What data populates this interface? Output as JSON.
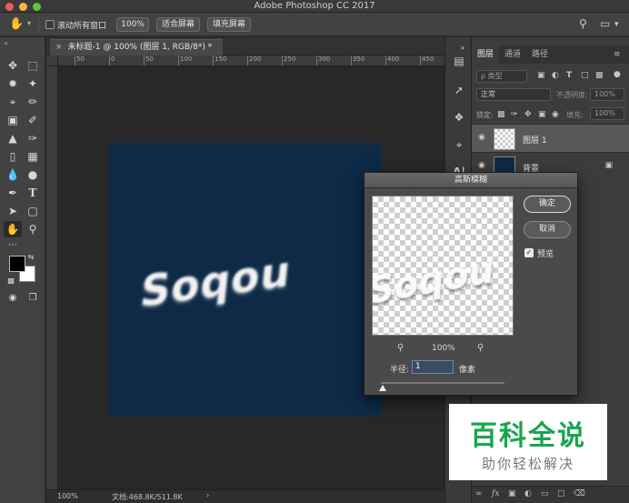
{
  "app": {
    "title": "Adobe Photoshop CC 2017"
  },
  "options_bar": {
    "scroll_all_label": "滚动所有窗口",
    "zoom_100_label": "100%",
    "fit_screen_label": "适合屏幕",
    "fill_screen_label": "填充屏幕"
  },
  "document": {
    "tab_title": "未标题-1 @ 100% (图层 1, RGB/8*) *",
    "close_glyph": "×"
  },
  "ruler": {
    "ticks": [
      "50",
      "0",
      "50",
      "100",
      "150",
      "200",
      "250",
      "300",
      "350",
      "400",
      "450"
    ]
  },
  "canvas": {
    "text": "Soqou",
    "background_color": "#0e2a47"
  },
  "status_bar": {
    "zoom": "100%",
    "doc_info": "文档:468.8K/511.8K",
    "arrow": "›"
  },
  "layers_panel": {
    "tabs": [
      {
        "label": "图层",
        "active": true
      },
      {
        "label": "通道",
        "active": false
      },
      {
        "label": "路径",
        "active": false
      }
    ],
    "filter_placeholder": "ρ 类型",
    "blend_mode": "正常",
    "opacity_label": "不透明度:",
    "opacity_value": "100%",
    "lock_label": "锁定:",
    "fill_label": "填充:",
    "fill_value": "100%",
    "layers": [
      {
        "name": "图层 1",
        "selected": true,
        "thumb": "transparent"
      },
      {
        "name": "背景",
        "selected": false,
        "thumb": "navy",
        "locked": true
      }
    ]
  },
  "dialog": {
    "title": "高斯模糊",
    "ok_label": "确定",
    "cancel_label": "取消",
    "preview_label": "预览",
    "preview_checked": true,
    "preview_text": "Soqou",
    "zoom_value": "100%",
    "radius_label": "半径:",
    "radius_value": "1",
    "radius_unit": "像素"
  },
  "watermark": {
    "title": "百科全说",
    "subtitle": "助你轻松解决"
  },
  "icons": {
    "hand": "hand-icon",
    "move": "move-icon",
    "marquee": "marquee-icon",
    "lasso": "lasso-icon",
    "magic-wand": "magic-wand-icon",
    "crop": "crop-icon",
    "eyedropper": "eyedropper-icon",
    "healing": "healing-brush-icon",
    "brush": "brush-icon",
    "stamp": "clone-stamp-icon",
    "history": "history-brush-icon",
    "eraser": "eraser-icon",
    "gradient": "gradient-icon",
    "blur": "blur-icon",
    "dodge": "dodge-icon",
    "pen": "pen-icon",
    "type": "type-icon",
    "path-select": "path-select-icon",
    "shape": "shape-icon",
    "zoom": "zoom-icon"
  }
}
